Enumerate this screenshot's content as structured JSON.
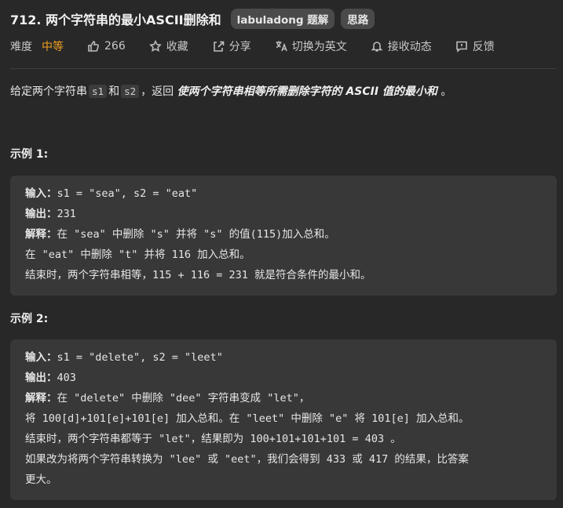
{
  "header": {
    "title": "712. 两个字符串的最小ASCII删除和",
    "tags": [
      "labuladong 题解",
      "思路"
    ]
  },
  "meta": {
    "difficulty_label": "难度",
    "difficulty_value": "中等",
    "likes": "266",
    "favorite": "收藏",
    "share": "分享",
    "translate": "切换为英文",
    "subscribe": "接收动态",
    "feedback": "反馈"
  },
  "colors": {
    "background": "#282828",
    "difficulty": "#f0a020",
    "code_box": "#383838"
  },
  "description": {
    "part1": "给定两个字符串",
    "code1": "s1",
    "part2": "和",
    "code2": "s2",
    "part3": "，返回 ",
    "emphasis": "使两个字符串相等所需删除字符的 ASCII 值的最小和",
    "part4": " 。"
  },
  "examples": [
    {
      "title": "示例 1:",
      "lines": [
        {
          "label": "输入：",
          "text": "s1 = \"sea\", s2 = \"eat\""
        },
        {
          "label": "输出：",
          "text": "231"
        },
        {
          "label": "解释：",
          "text": "在 \"sea\" 中删除 \"s\" 并将 \"s\" 的值(115)加入总和。"
        },
        {
          "label": "",
          "text": "在 \"eat\" 中删除 \"t\" 并将 116 加入总和。"
        },
        {
          "label": "",
          "text": "结束时，两个字符串相等，115 + 116 = 231 就是符合条件的最小和。"
        }
      ]
    },
    {
      "title": "示例 2:",
      "lines": [
        {
          "label": "输入：",
          "text": "s1 = \"delete\", s2 = \"leet\""
        },
        {
          "label": "输出：",
          "text": "403"
        },
        {
          "label": "解释：",
          "text": "在 \"delete\" 中删除 \"dee\" 字符串变成 \"let\"，"
        },
        {
          "label": "",
          "text": "将 100[d]+101[e]+101[e] 加入总和。在 \"leet\" 中删除 \"e\" 将 101[e] 加入总和。"
        },
        {
          "label": "",
          "text": "结束时，两个字符串都等于 \"let\"，结果即为 100+101+101+101 = 403 。"
        },
        {
          "label": "",
          "text": "如果改为将两个字符串转换为 \"lee\" 或 \"eet\"，我们会得到 433 或 417 的结果，比答案"
        },
        {
          "label": "",
          "text": "更大。"
        }
      ]
    }
  ]
}
